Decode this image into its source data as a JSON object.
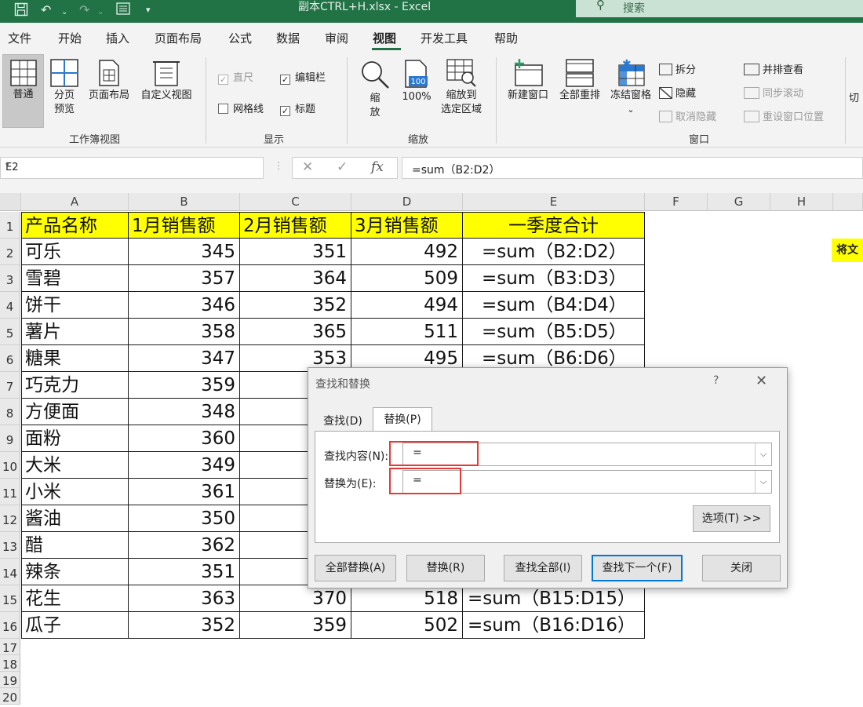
{
  "titlebar": {
    "doc_title": "副本CTRL+H.xlsx  -  Excel",
    "search_placeholder": "搜索"
  },
  "menu": {
    "items": [
      "文件",
      "开始",
      "插入",
      "页面布局",
      "公式",
      "数据",
      "审阅",
      "视图",
      "开发工具",
      "帮助"
    ],
    "active": "视图"
  },
  "ribbon": {
    "workbook_views": {
      "group_label": "工作簿视图",
      "normal": "普通",
      "page_break_1": "分页",
      "page_break_2": "预览",
      "page_layout": "页面布局",
      "custom_views": "自定义视图"
    },
    "show": {
      "group_label": "显示",
      "ruler": "直尺",
      "formula_bar": "编辑栏",
      "gridlines": "网格线",
      "headings": "标题"
    },
    "zoom": {
      "group_label": "缩放",
      "zoom_1": "缩",
      "zoom_2": "放",
      "zoom_100": "100%",
      "zoom_sel_1": "缩放到",
      "zoom_sel_2": "选定区域",
      "icon_100": "100"
    },
    "window": {
      "group_label": "窗口",
      "new_window": "新建窗口",
      "arrange_all": "全部重排",
      "freeze_panes": "冻结窗格",
      "split": "拆分",
      "hide": "隐藏",
      "unhide": "取消隐藏",
      "side_by_side": "并排查看",
      "sync_scroll": "同步滚动",
      "reset_position": "重设窗口位置",
      "switch_partial": "切"
    }
  },
  "formula_bar": {
    "name_box": "E2",
    "fx": "fx",
    "formula": "=sum（B2:D2）"
  },
  "sheet": {
    "columns": [
      "A",
      "B",
      "C",
      "D",
      "E",
      "F",
      "G",
      "H"
    ],
    "rows": [
      "1",
      "2",
      "3",
      "4",
      "5",
      "6",
      "7",
      "8",
      "9",
      "10",
      "11",
      "12",
      "13",
      "14",
      "15",
      "16",
      "17",
      "18",
      "19",
      "20"
    ],
    "header": [
      "产品名称",
      "1月销售额",
      "2月销售额",
      "3月销售额",
      "一季度合计"
    ],
    "data": [
      [
        "可乐",
        "345",
        "351",
        "492",
        "=sum（B2:D2）"
      ],
      [
        "雪碧",
        "357",
        "364",
        "509",
        "=sum（B3:D3）"
      ],
      [
        "饼干",
        "346",
        "352",
        "494",
        "=sum（B4:D4）"
      ],
      [
        "薯片",
        "358",
        "365",
        "511",
        "=sum（B5:D5）"
      ],
      [
        "糖果",
        "347",
        "353",
        "495",
        "=sum（B6:D6）"
      ],
      [
        "巧克力",
        "359",
        "",
        "",
        ""
      ],
      [
        "方便面",
        "348",
        "",
        "",
        ""
      ],
      [
        "面粉",
        "360",
        "",
        "",
        ""
      ],
      [
        "大米",
        "349",
        "",
        "",
        ""
      ],
      [
        "小米",
        "361",
        "",
        "",
        ""
      ],
      [
        "酱油",
        "350",
        "",
        "",
        ""
      ],
      [
        "醋",
        "362",
        "",
        "",
        ""
      ],
      [
        "辣条",
        "351",
        "",
        "",
        ""
      ],
      [
        "花生",
        "363",
        "370",
        "518",
        "=sum（B15:D15）"
      ],
      [
        "瓜子",
        "352",
        "359",
        "502",
        "=sum（B16:D16）"
      ]
    ],
    "side_note": "将文"
  },
  "dialog": {
    "title": "查找和替换",
    "help": "?",
    "tab_find": "查找(D)",
    "tab_replace": "替换(P)",
    "find_label": "查找内容(N):",
    "find_value": "=",
    "replace_label": "替换为(E):",
    "replace_value": "=",
    "options_btn": "选项(T) >>",
    "replace_all_btn": "全部替换(A)",
    "replace_btn": "替换(R)",
    "find_all_btn": "查找全部(I)",
    "find_next_btn": "查找下一个(F)",
    "close_btn": "关闭"
  }
}
